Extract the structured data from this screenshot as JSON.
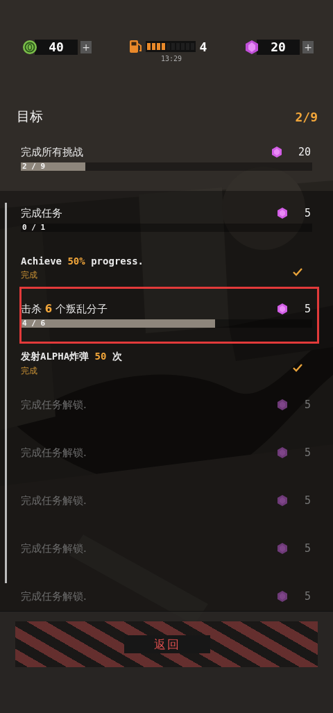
{
  "resources": [
    {
      "kind": "coin",
      "value": "40",
      "plus": "+"
    },
    {
      "kind": "fuel",
      "level": 0.4,
      "value": "4",
      "timer": "13:29"
    },
    {
      "kind": "gem",
      "value": "20",
      "plus": "+"
    }
  ],
  "header": {
    "title": "目标",
    "count": "2/9"
  },
  "goal": {
    "title": "完成所有挑战",
    "reward": "20",
    "progress": "2 / 9",
    "level": 0.222
  },
  "missions": [
    {
      "kind": "progress",
      "title": "完成任务",
      "reward": "5",
      "progress": "0 / 1",
      "level": 0,
      "highlighted": false
    },
    {
      "kind": "done",
      "title": "Achieve **50%** progress.",
      "status": "完成",
      "highlighted": false
    },
    {
      "kind": "progress",
      "title": "击杀 **6** 个叛乱分子",
      "reward": "5",
      "progress": "4 / 6",
      "level": 0.667,
      "highlighted": true
    },
    {
      "kind": "done",
      "title": "发射ALPHA炸弹 **50** 次",
      "status": "完成",
      "highlighted": false
    },
    {
      "kind": "locked",
      "title": "完成任务解锁.",
      "reward": "5",
      "highlighted": false
    },
    {
      "kind": "locked",
      "title": "完成任务解锁.",
      "reward": "5",
      "highlighted": false
    },
    {
      "kind": "locked",
      "title": "完成任务解锁.",
      "reward": "5",
      "highlighted": false
    },
    {
      "kind": "locked",
      "title": "完成任务解锁.",
      "reward": "5",
      "highlighted": false
    },
    {
      "kind": "locked",
      "title": "完成任务解锁.",
      "reward": "5",
      "highlighted": false
    }
  ],
  "back_button": "返回"
}
